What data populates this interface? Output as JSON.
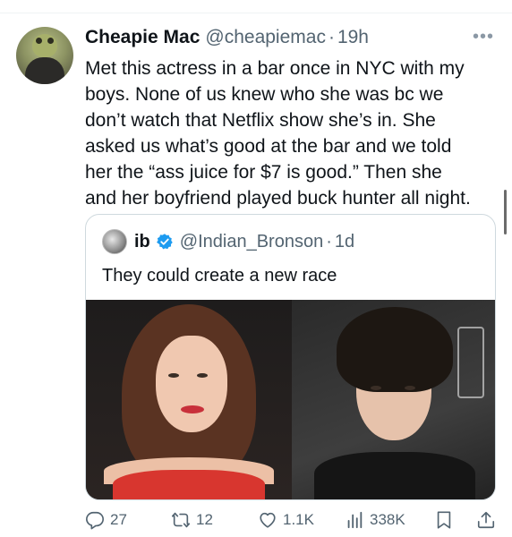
{
  "tweet": {
    "author_name": "Cheapie Mac",
    "author_handle": "@cheapiemac",
    "separator": "·",
    "time": "19h",
    "more_icon": "more-icon",
    "lines": [
      "Met this actress in a bar once in NYC with my",
      "boys. None of us knew who she was bc we",
      "don’t watch that Netflix show she’s in. She",
      "asked us what’s good at the bar and we told",
      "her the “ass juice for $7 is good.” Then she",
      "and her boyfriend played buck hunter all night."
    ]
  },
  "quote": {
    "author_name": "ib",
    "author_handle": "@Indian_Bronson",
    "separator": "·",
    "time": "1d",
    "verified_icon": "verified-badge-icon",
    "text": "They could create a new race"
  },
  "actions": {
    "replies": "27",
    "reposts": "12",
    "likes": "1.1K",
    "views": "338K"
  },
  "colors": {
    "text_primary": "#0f1419",
    "text_secondary": "#536471",
    "border": "#cfd9de",
    "verified": "#1d9bf0"
  }
}
